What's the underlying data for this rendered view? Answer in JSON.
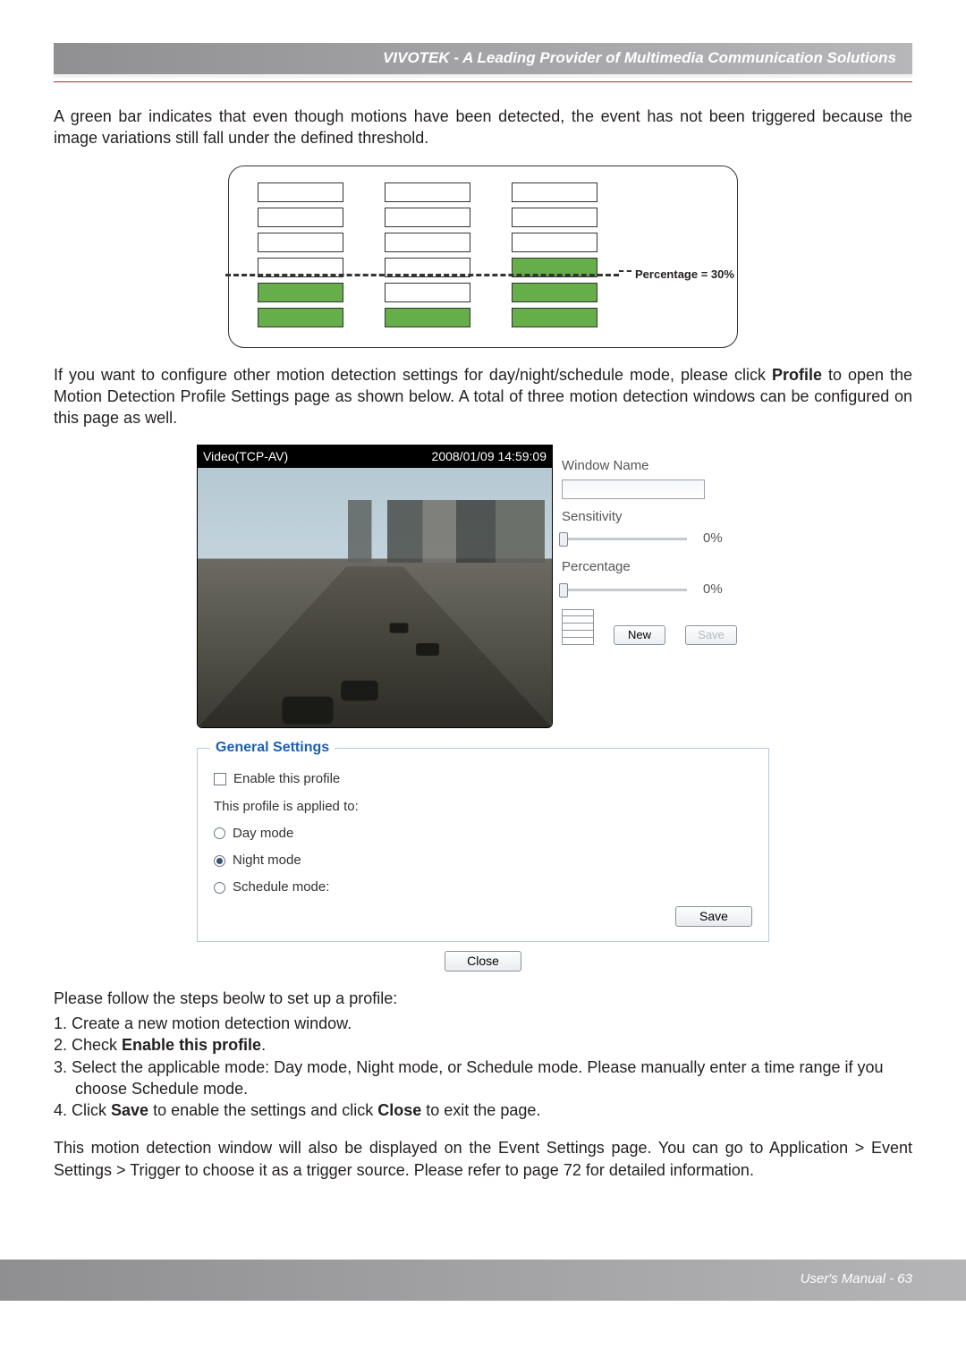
{
  "header": {
    "title": "VIVOTEK - A Leading Provider of Multimedia Communication Solutions"
  },
  "para1": "A green bar indicates that even though motions have been detected, the event has not been triggered because the image variations still fall under the defined threshold.",
  "fig1": {
    "pct_label": "Percentage = 30%"
  },
  "para2_a": "If you want to configure other motion detection settings for day/night/schedule mode, please click ",
  "para2_b": "Profile",
  "para2_c": " to open the Motion Detection Profile Settings page as shown below. A total of three motion detection windows can be configured on this page as well.",
  "video": {
    "title": "Video(TCP-AV)",
    "timestamp": "2008/01/09 14:59:09"
  },
  "panel": {
    "window_name": "Window Name",
    "sensitivity": "Sensitivity",
    "percentage": "Percentage",
    "sens_val": "0%",
    "pct_val": "0%",
    "new_btn": "New",
    "save_btn": "Save"
  },
  "gs": {
    "legend": "General Settings",
    "enable": "Enable this profile",
    "applied": "This profile is applied to:",
    "day": "Day mode",
    "night": "Night mode",
    "schedule": "Schedule mode:",
    "save": "Save"
  },
  "close_btn": "Close",
  "steps_intro": "Please follow the steps beolw to set up a profile:",
  "steps": {
    "s1": "1. Create a new motion detection window.",
    "s2a": "2. Check ",
    "s2b": "Enable this profile",
    "s2c": ".",
    "s3": "3. Select the applicable mode: Day mode, Night mode, or Schedule mode. Please manually enter a time range if you choose Schedule mode.",
    "s4a": "4. Click ",
    "s4b": "Save",
    "s4c": " to enable the settings and click ",
    "s4d": "Close",
    "s4e": " to exit the page."
  },
  "para3": "This motion detection window will also be displayed on the Event Settings page. You can go to Application > Event Settings > Trigger to choose it as a trigger source. Please refer to page 72 for detailed information.",
  "footer": {
    "text": "User's Manual - 63"
  }
}
